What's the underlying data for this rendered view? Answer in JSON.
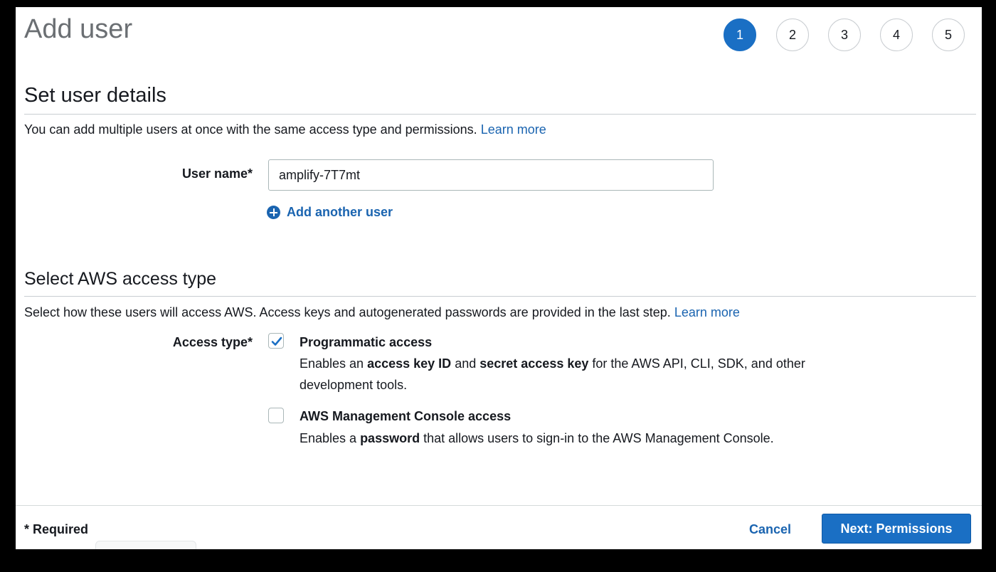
{
  "header": {
    "title": "Add user"
  },
  "steps": [
    "1",
    "2",
    "3",
    "4",
    "5"
  ],
  "active_step": "1",
  "user_details": {
    "title": "Set user details",
    "description": "You can add multiple users at once with the same access type and permissions.",
    "learn_more": "Learn more",
    "user_name_label": "User name*",
    "user_name_value": "amplify-7T7mt",
    "add_another_user": "Add another user"
  },
  "access_type": {
    "title": "Select AWS access type",
    "description": "Select how these users will access AWS. Access keys and autogenerated passwords are provided in the last step.",
    "learn_more": "Learn more",
    "label": "Access type*",
    "options": [
      {
        "title": "Programmatic access",
        "checked": true,
        "desc_parts": [
          "Enables an ",
          "access key ID",
          " and ",
          "secret access key",
          " for the AWS API, CLI, SDK, and other development tools."
        ]
      },
      {
        "title": "AWS Management Console access",
        "checked": false,
        "desc_parts": [
          "Enables a ",
          "password",
          " that allows users to sign-in to the AWS Management Console."
        ]
      }
    ]
  },
  "footer": {
    "required": "* Required",
    "cancel": "Cancel",
    "next": "Next: Permissions"
  },
  "colors": {
    "primary": "#1a6fc4",
    "link": "#1a64b0"
  }
}
